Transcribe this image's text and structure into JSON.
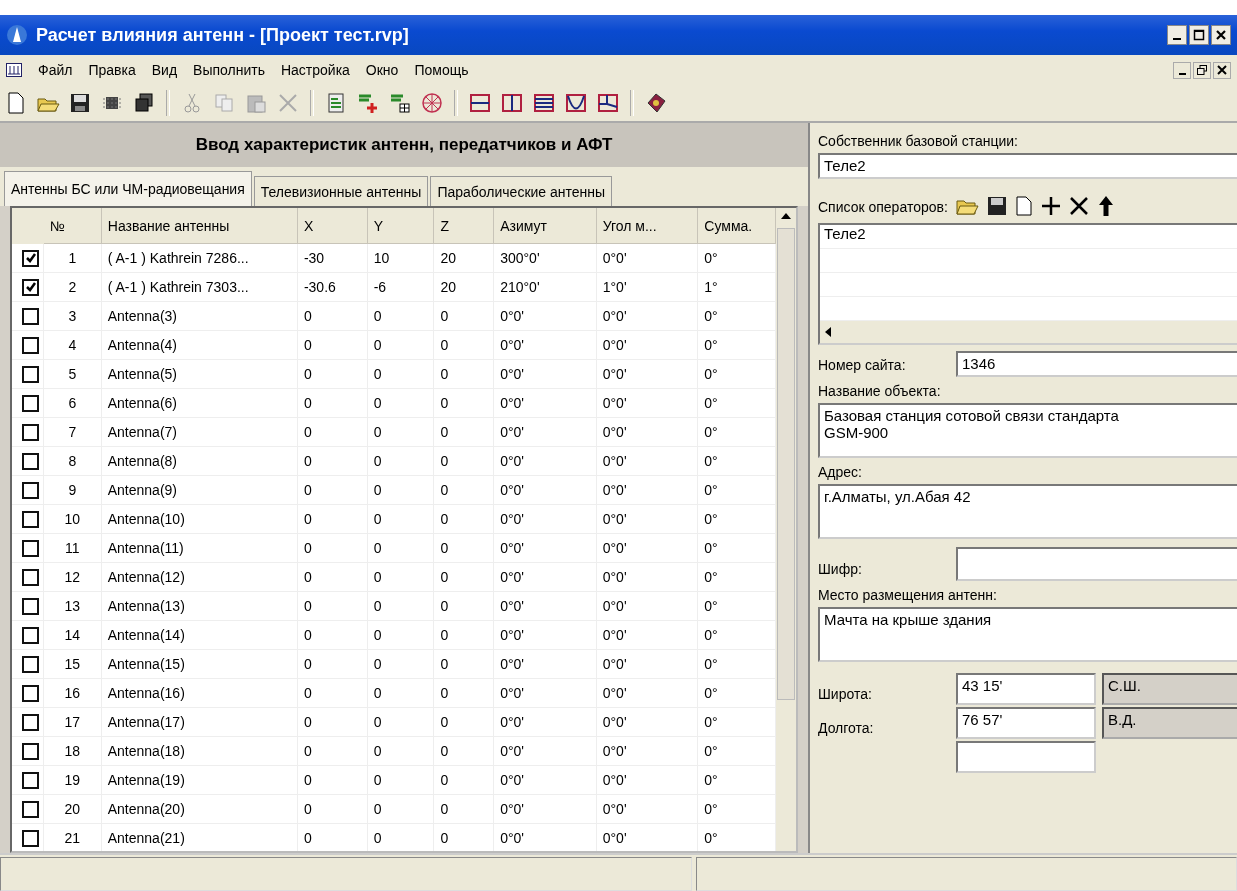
{
  "window": {
    "title": "Расчет влияния антенн - [Проект тест.rvp]"
  },
  "menu": [
    "Файл",
    "Правка",
    "Вид",
    "Выполнить",
    "Настройка",
    "Окно",
    "Помощь"
  ],
  "panel_title": "Ввод характеристик антенн, передатчиков и АФТ",
  "tabs": [
    {
      "label": "Антенны БС или ЧМ-радиовещания",
      "selected": true
    },
    {
      "label": "Телевизионные антенны",
      "selected": false
    },
    {
      "label": "Параболические антенны",
      "selected": false
    }
  ],
  "table": {
    "columns": [
      "№",
      "Название антенны",
      "X",
      "Y",
      "Z",
      "Азимут",
      "Угол м...",
      "Сумма."
    ],
    "rows": [
      {
        "checked": true,
        "cells": [
          "1",
          "( A-1 ) Kathrein 7286...",
          "-30",
          "10",
          "20",
          "300°0'",
          "0°0'",
          "0°"
        ]
      },
      {
        "checked": true,
        "cells": [
          "2",
          "( A-1 ) Kathrein 7303...",
          "-30.6",
          "-6",
          "20",
          "210°0'",
          "1°0'",
          "1°"
        ]
      },
      {
        "checked": false,
        "cells": [
          "3",
          "Antenna(3)",
          "0",
          "0",
          "0",
          "0°0'",
          "0°0'",
          "0°"
        ]
      },
      {
        "checked": false,
        "cells": [
          "4",
          "Antenna(4)",
          "0",
          "0",
          "0",
          "0°0'",
          "0°0'",
          "0°"
        ]
      },
      {
        "checked": false,
        "cells": [
          "5",
          "Antenna(5)",
          "0",
          "0",
          "0",
          "0°0'",
          "0°0'",
          "0°"
        ]
      },
      {
        "checked": false,
        "cells": [
          "6",
          "Antenna(6)",
          "0",
          "0",
          "0",
          "0°0'",
          "0°0'",
          "0°"
        ]
      },
      {
        "checked": false,
        "cells": [
          "7",
          "Antenna(7)",
          "0",
          "0",
          "0",
          "0°0'",
          "0°0'",
          "0°"
        ]
      },
      {
        "checked": false,
        "cells": [
          "8",
          "Antenna(8)",
          "0",
          "0",
          "0",
          "0°0'",
          "0°0'",
          "0°"
        ]
      },
      {
        "checked": false,
        "cells": [
          "9",
          "Antenna(9)",
          "0",
          "0",
          "0",
          "0°0'",
          "0°0'",
          "0°"
        ]
      },
      {
        "checked": false,
        "cells": [
          "10",
          "Antenna(10)",
          "0",
          "0",
          "0",
          "0°0'",
          "0°0'",
          "0°"
        ]
      },
      {
        "checked": false,
        "cells": [
          "11",
          "Antenna(11)",
          "0",
          "0",
          "0",
          "0°0'",
          "0°0'",
          "0°"
        ]
      },
      {
        "checked": false,
        "cells": [
          "12",
          "Antenna(12)",
          "0",
          "0",
          "0",
          "0°0'",
          "0°0'",
          "0°"
        ]
      },
      {
        "checked": false,
        "cells": [
          "13",
          "Antenna(13)",
          "0",
          "0",
          "0",
          "0°0'",
          "0°0'",
          "0°"
        ]
      },
      {
        "checked": false,
        "cells": [
          "14",
          "Antenna(14)",
          "0",
          "0",
          "0",
          "0°0'",
          "0°0'",
          "0°"
        ]
      },
      {
        "checked": false,
        "cells": [
          "15",
          "Antenna(15)",
          "0",
          "0",
          "0",
          "0°0'",
          "0°0'",
          "0°"
        ]
      },
      {
        "checked": false,
        "cells": [
          "16",
          "Antenna(16)",
          "0",
          "0",
          "0",
          "0°0'",
          "0°0'",
          "0°"
        ]
      },
      {
        "checked": false,
        "cells": [
          "17",
          "Antenna(17)",
          "0",
          "0",
          "0",
          "0°0'",
          "0°0'",
          "0°"
        ]
      },
      {
        "checked": false,
        "cells": [
          "18",
          "Antenna(18)",
          "0",
          "0",
          "0",
          "0°0'",
          "0°0'",
          "0°"
        ]
      },
      {
        "checked": false,
        "cells": [
          "19",
          "Antenna(19)",
          "0",
          "0",
          "0",
          "0°0'",
          "0°0'",
          "0°"
        ]
      },
      {
        "checked": false,
        "cells": [
          "20",
          "Antenna(20)",
          "0",
          "0",
          "0",
          "0°0'",
          "0°0'",
          "0°"
        ]
      },
      {
        "checked": false,
        "cells": [
          "21",
          "Antenna(21)",
          "0",
          "0",
          "0",
          "0°0'",
          "0°0'",
          "0°"
        ]
      }
    ]
  },
  "form": {
    "owner": {
      "label": "Собственник базовой станции:",
      "value": "Теле2"
    },
    "operators": {
      "label": "Список операторов:",
      "items": [
        "Теле2"
      ]
    },
    "site_number": {
      "label": "Номер сайта:",
      "value": "1346"
    },
    "object_name": {
      "label": "Название объекта:",
      "value": "Базовая станция сотовой связи стандарта GSM-900"
    },
    "address": {
      "label": "Адрес:",
      "value": "г.Алматы, ул.Абая 42"
    },
    "cipher": {
      "label": "Шифр:"
    },
    "placement": {
      "label": "Место размещения антенн:",
      "value": "Мачта на крыше здания"
    },
    "latitude": {
      "label": "Широта:",
      "value": "43 15'",
      "hemisphere": "С.Ш."
    },
    "longitude": {
      "label": "Долгота:",
      "value": "76 57'",
      "hemisphere": "В.Д."
    }
  }
}
